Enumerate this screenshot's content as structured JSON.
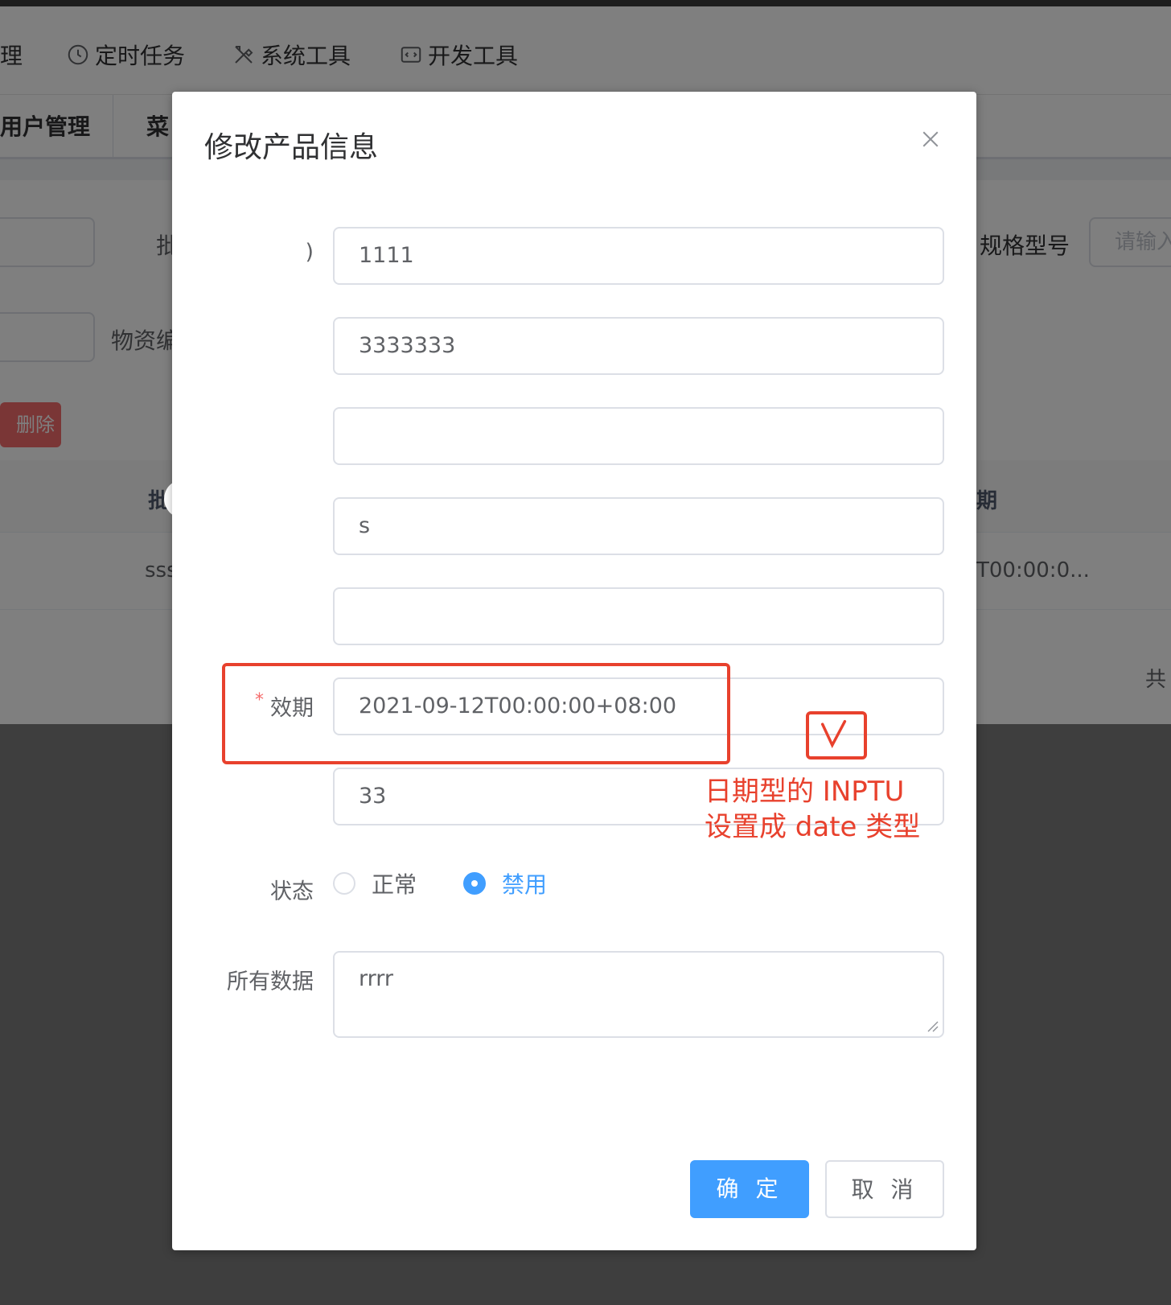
{
  "background": {
    "nav": [
      {
        "label": "理",
        "icon": ""
      },
      {
        "label": "定时任务",
        "icon": "clock-icon"
      },
      {
        "label": "系统工具",
        "icon": "tools-icon"
      },
      {
        "label": "开发工具",
        "icon": "code-icon"
      }
    ],
    "tags": [
      {
        "label": "用户管理"
      },
      {
        "label": "菜"
      }
    ],
    "search": {
      "label_batch": "批",
      "label_material": "物资编",
      "label_spec": "规格型号",
      "spec_placeholder": "请输入"
    },
    "delete_label": "删除",
    "table": {
      "header_batch": "批",
      "header_date": "期",
      "cell_batch": "sss",
      "cell_date": "T00:00:0..."
    },
    "total_label": "共"
  },
  "dialog": {
    "title": "修改产品信息",
    "fields": [
      {
        "label": ")",
        "value": "1111"
      },
      {
        "label": "",
        "value": "3333333"
      },
      {
        "label": "",
        "value": ""
      },
      {
        "label": "",
        "value": "s"
      },
      {
        "label": "",
        "value": ""
      },
      {
        "label": "效期",
        "value": "2021-09-12T00:00:00+08:00",
        "required": true
      },
      {
        "label": "",
        "value": "33"
      }
    ],
    "status": {
      "label": "状态",
      "options": [
        {
          "label": "正常",
          "checked": false
        },
        {
          "label": "禁用",
          "checked": true
        }
      ]
    },
    "all_data": {
      "label": "所有数据",
      "value": "rrrr"
    },
    "confirm_label": "确 定",
    "cancel_label": "取 消"
  },
  "annotation": {
    "check_mark": "√",
    "line1": "日期型的 INPTU",
    "line2": "设置成 date 类型"
  },
  "colors": {
    "primary": "#409eff",
    "danger": "#f56c6c",
    "annotation": "#e8412d"
  }
}
